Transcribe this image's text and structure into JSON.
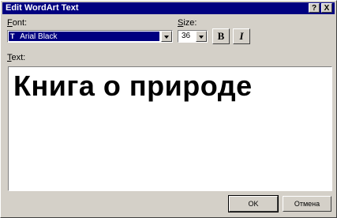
{
  "window": {
    "title": "Edit WordArt Text",
    "help_label": "?",
    "close_label": "X"
  },
  "font": {
    "label_hotkey": "F",
    "label_rest": "ont:",
    "value": "Arial Black",
    "icon_glyph": "T"
  },
  "size": {
    "label_hotkey": "S",
    "label_rest": "ize:",
    "value": "36"
  },
  "format": {
    "bold_label": "B",
    "italic_label": "I"
  },
  "text": {
    "label_hotkey": "T",
    "label_rest": "ext:",
    "value": "Книга о природе"
  },
  "buttons": {
    "ok_label": "OK",
    "cancel_label": "Отмена"
  }
}
